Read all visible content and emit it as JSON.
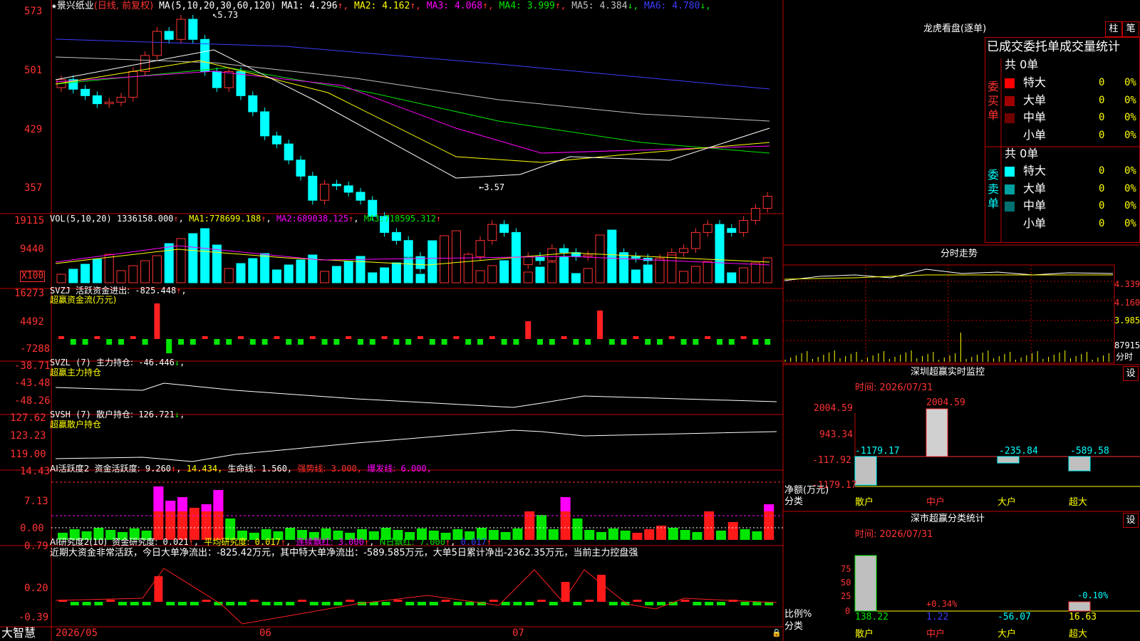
{
  "main": {
    "stock_name": "景兴纸业",
    "period": "(日线, 前复权)",
    "ma_label": "MA(5,10,20,30,60,120)",
    "ma_values": [
      {
        "name": "MA1:",
        "value": "4.296",
        "arrow": "↑",
        "color": "#ffffff"
      },
      {
        "name": "MA2:",
        "value": "4.162",
        "arrow": "↑",
        "color": "#ffff00"
      },
      {
        "name": "MA3:",
        "value": "4.068",
        "arrow": "↑",
        "color": "#ff00ff"
      },
      {
        "name": "MA4:",
        "value": "3.999",
        "arrow": "↑",
        "color": "#00e600"
      },
      {
        "name": "MA5:",
        "value": "4.384",
        "arrow": "↓",
        "color": "#c0c0c0"
      },
      {
        "name": "MA6:",
        "value": "4.780",
        "arrow": "↓",
        "color": "#3c3cff"
      }
    ],
    "y_ticks": [
      "573",
      "501",
      "429",
      "357"
    ],
    "high_label": "5.73",
    "low_label": "←3.57"
  },
  "vol": {
    "title": "VOL(5,10,20)",
    "value": "1336158.000",
    "ma": [
      {
        "name": "MA1:",
        "value": "778699.188",
        "color": "#ffff00"
      },
      {
        "name": "MA2:",
        "value": "689038.125",
        "color": "#ff00ff"
      },
      {
        "name": "MA3:",
        "value": "718595.312",
        "color": "#00e600"
      }
    ],
    "y_ticks": [
      "19115",
      "9440"
    ],
    "unit": "X100"
  },
  "svzj": {
    "title": "SVZJ",
    "label": "活跃资金进出:",
    "value": "-825.448",
    "subtitle": "超赢资金流(万元)",
    "y_ticks": [
      "16273",
      "4492",
      "-7288"
    ]
  },
  "svzl": {
    "title": "SVZL (7)",
    "label": "主力持仓:",
    "value": "-46.446",
    "subtitle": "超赢主力持仓",
    "y_ticks": [
      "-38.71",
      "-43.48",
      "-48.26"
    ]
  },
  "svsh": {
    "title": "SVSH (7)",
    "label": "散户持仓:",
    "value": "126.721",
    "subtitle": "超赢散户持仓",
    "y_ticks": [
      "127.62",
      "123.23",
      "119.00"
    ]
  },
  "ai2": {
    "title": "AI活跃度2",
    "label": "资金活跃度:",
    "value": "9.260",
    "v2": "14.434,",
    "life_label": "生命线:",
    "life_value": "1.560,",
    "strong_label": "强势线:",
    "strong_value": "3.000,",
    "burst_label": "爆发线:",
    "burst_value": "6.000,",
    "y_ticks": [
      "14.43",
      "7.13",
      "0.00"
    ]
  },
  "ai_research": {
    "title": "AI研究度2(10)",
    "label": "资金研究度:",
    "value": "0.021",
    "avg_label": "平均研究度:",
    "avg_value": "0.017",
    "red_label": "连续飘红:",
    "red_value": "3.000",
    "n_label": "N日飘红:",
    "n_value": "7.000",
    "last_value": "0.017",
    "commentary": "近期大资金非常活跃，今日大单净流出：-825.42万元，其中特大单净流出：-589.585万元，大单5日累计净出-2362.35万元，当前主力控盘强",
    "y_ticks": [
      "0.79",
      "0.20",
      "-0.39"
    ]
  },
  "xaxis": {
    "brand": "大智慧",
    "labels": [
      "2026/05",
      "06",
      "07"
    ]
  },
  "right": {
    "dragon_title": "龙虎看盘(逐单)",
    "btn_bar": "柱",
    "btn_stroke": "笔",
    "stats_title": "已成交委托单成交量统计",
    "buy_side": "委买单",
    "sell_side": "委卖单",
    "buy_total": "共 0单",
    "sell_total": "共 0单",
    "buy_rows": [
      {
        "label": "特大",
        "count": "0",
        "pct": "0%",
        "color": "#ff0000"
      },
      {
        "label": "大单",
        "count": "0",
        "pct": "0%",
        "color": "#a00000"
      },
      {
        "label": "中单",
        "count": "0",
        "pct": "0%",
        "color": "#700000"
      },
      {
        "label": "小单",
        "count": "0",
        "pct": "0%",
        "color": ""
      }
    ],
    "sell_rows": [
      {
        "label": "特大",
        "count": "0",
        "pct": "0%",
        "color": "#00ffff"
      },
      {
        "label": "大单",
        "count": "0",
        "pct": "0%",
        "color": "#00a0a0"
      },
      {
        "label": "中单",
        "count": "0",
        "pct": "0%",
        "color": "#007070"
      },
      {
        "label": "小单",
        "count": "0",
        "pct": "0%",
        "color": ""
      }
    ],
    "intraday_title": "分时走势",
    "intraday_ticks": [
      "4.339",
      "4.160",
      "3.985",
      "87915"
    ],
    "intraday_unit": "分时",
    "sz_monitor_title": "深圳超赢实时监控",
    "sz_monitor_set": "设",
    "sz_time": "时间: 2026/07/31",
    "sz_y_ticks": [
      "2004.59",
      "943.34",
      "-117.92",
      "-1179.17"
    ],
    "sz_axis_label": "净额(万元)",
    "sz_axis_label2": "分类",
    "sz_values": [
      "-1179.17",
      "2004.59",
      "-235.84",
      "-589.58"
    ],
    "sz_categories": [
      "散户",
      "中户",
      "大户",
      "超大"
    ],
    "class_title": "深市超赢分类统计",
    "class_set": "设",
    "class_time": "时间: 2026/07/31",
    "class_y_ticks": [
      "75",
      "50",
      "25",
      "0"
    ],
    "class_axis_label": "比例%",
    "class_axis_label2": "分类",
    "class_pcts": [
      "+0.34%",
      "-0.10%"
    ],
    "class_values": [
      "138.22",
      "1.22",
      "-56.07",
      "16.63"
    ],
    "class_categories": [
      "散户",
      "中户",
      "大户",
      "超大"
    ]
  }
}
